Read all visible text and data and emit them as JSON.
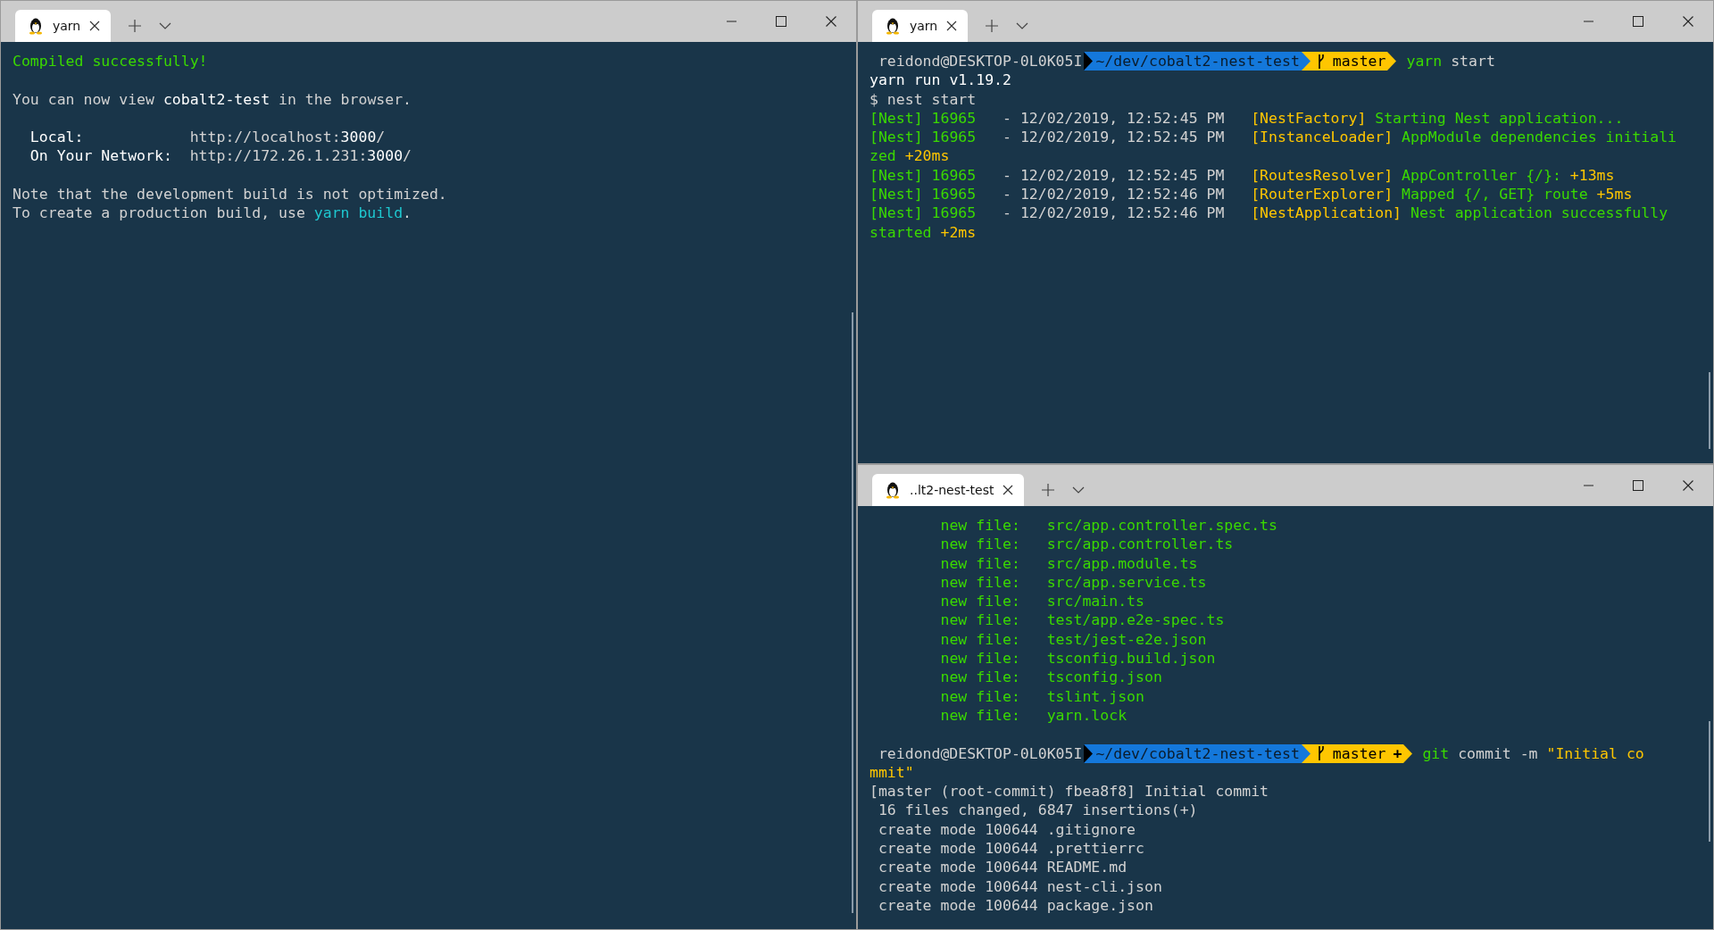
{
  "windows": [
    {
      "tab": {
        "title": "yarn"
      },
      "lines": [
        {
          "kind": "text",
          "spans": [
            {
              "text": "Compiled successfully!",
              "color": "#3ad900"
            }
          ]
        },
        {
          "kind": "blank"
        },
        {
          "kind": "text",
          "spans": [
            {
              "text": "You can now view ",
              "color": "#d2d2d2"
            },
            {
              "text": "cobalt2-test",
              "color": "#ffffff"
            },
            {
              "text": " in the browser.",
              "color": "#d2d2d2"
            }
          ]
        },
        {
          "kind": "blank"
        },
        {
          "kind": "text",
          "spans": [
            {
              "text": "  Local:",
              "color": "#ffffff"
            },
            {
              "text": "            http://localhost:",
              "color": "#d2d2d2"
            },
            {
              "text": "3000",
              "color": "#ffffff"
            },
            {
              "text": "/",
              "color": "#d2d2d2"
            }
          ]
        },
        {
          "kind": "text",
          "spans": [
            {
              "text": "  On Your Network:",
              "color": "#ffffff"
            },
            {
              "text": "  http://172.26.1.231:",
              "color": "#d2d2d2"
            },
            {
              "text": "3000",
              "color": "#ffffff"
            },
            {
              "text": "/",
              "color": "#d2d2d2"
            }
          ]
        },
        {
          "kind": "blank"
        },
        {
          "kind": "text",
          "spans": [
            {
              "text": "Note that the development build is not optimized.",
              "color": "#d2d2d2"
            }
          ]
        },
        {
          "kind": "text",
          "spans": [
            {
              "text": "To create a production build, use ",
              "color": "#d2d2d2"
            },
            {
              "text": "yarn build",
              "color": "#1ec8d0"
            },
            {
              "text": ".",
              "color": "#d2d2d2"
            }
          ]
        }
      ]
    },
    {
      "tab": {
        "title": "yarn"
      },
      "lines": [
        {
          "kind": "prompt",
          "user": "reidond@DESKTOP-0L0K05I",
          "path": "~/dev/cobalt2-nest-test",
          "branch": "master",
          "command": [
            {
              "text": "yarn",
              "color": "#3ad900"
            },
            {
              "text": " start",
              "color": "#d2d2d2"
            }
          ]
        },
        {
          "kind": "text",
          "spans": [
            {
              "text": "yarn run v1.19.2",
              "color": "#ffffff"
            }
          ]
        },
        {
          "kind": "text",
          "spans": [
            {
              "text": "$ nest start",
              "color": "#d2d2d2"
            }
          ]
        },
        {
          "kind": "text",
          "spans": [
            {
              "text": "[Nest] 16965",
              "color": "#3ad900"
            },
            {
              "text": "   - 12/02/2019, 12:52:45 PM   ",
              "color": "#d2d2d2"
            },
            {
              "text": "[NestFactory]",
              "color": "#ffc600"
            },
            {
              "text": " Starting Nest application...",
              "color": "#3ad900"
            }
          ]
        },
        {
          "kind": "text",
          "spans": [
            {
              "text": "[Nest] 16965",
              "color": "#3ad900"
            },
            {
              "text": "   - 12/02/2019, 12:52:45 PM   ",
              "color": "#d2d2d2"
            },
            {
              "text": "[InstanceLoader]",
              "color": "#ffc600"
            },
            {
              "text": " AppModule dependencies initiali",
              "color": "#3ad900"
            }
          ]
        },
        {
          "kind": "text",
          "spans": [
            {
              "text": "zed ",
              "color": "#3ad900"
            },
            {
              "text": "+20ms",
              "color": "#ffc600"
            }
          ]
        },
        {
          "kind": "text",
          "spans": [
            {
              "text": "[Nest] 16965",
              "color": "#3ad900"
            },
            {
              "text": "   - 12/02/2019, 12:52:45 PM   ",
              "color": "#d2d2d2"
            },
            {
              "text": "[RoutesResolver]",
              "color": "#ffc600"
            },
            {
              "text": " AppController {/}: ",
              "color": "#3ad900"
            },
            {
              "text": "+13ms",
              "color": "#ffc600"
            }
          ]
        },
        {
          "kind": "text",
          "spans": [
            {
              "text": "[Nest] 16965",
              "color": "#3ad900"
            },
            {
              "text": "   - 12/02/2019, 12:52:46 PM   ",
              "color": "#d2d2d2"
            },
            {
              "text": "[RouterExplorer]",
              "color": "#ffc600"
            },
            {
              "text": " Mapped {/, GET} route ",
              "color": "#3ad900"
            },
            {
              "text": "+5ms",
              "color": "#ffc600"
            }
          ]
        },
        {
          "kind": "text",
          "spans": [
            {
              "text": "[Nest] 16965",
              "color": "#3ad900"
            },
            {
              "text": "   - 12/02/2019, 12:52:46 PM   ",
              "color": "#d2d2d2"
            },
            {
              "text": "[NestApplication]",
              "color": "#ffc600"
            },
            {
              "text": " Nest application successfully",
              "color": "#3ad900"
            }
          ]
        },
        {
          "kind": "text",
          "spans": [
            {
              "text": "started ",
              "color": "#3ad900"
            },
            {
              "text": "+2ms",
              "color": "#ffc600"
            }
          ]
        }
      ]
    },
    {
      "tab": {
        "title": "..lt2-nest-test"
      },
      "lines": [
        {
          "kind": "text",
          "spans": [
            {
              "text": "        new file:   src/app.controller.spec.ts",
              "color": "#3ad900"
            }
          ]
        },
        {
          "kind": "text",
          "spans": [
            {
              "text": "        new file:   src/app.controller.ts",
              "color": "#3ad900"
            }
          ]
        },
        {
          "kind": "text",
          "spans": [
            {
              "text": "        new file:   src/app.module.ts",
              "color": "#3ad900"
            }
          ]
        },
        {
          "kind": "text",
          "spans": [
            {
              "text": "        new file:   src/app.service.ts",
              "color": "#3ad900"
            }
          ]
        },
        {
          "kind": "text",
          "spans": [
            {
              "text": "        new file:   src/main.ts",
              "color": "#3ad900"
            }
          ]
        },
        {
          "kind": "text",
          "spans": [
            {
              "text": "        new file:   test/app.e2e-spec.ts",
              "color": "#3ad900"
            }
          ]
        },
        {
          "kind": "text",
          "spans": [
            {
              "text": "        new file:   test/jest-e2e.json",
              "color": "#3ad900"
            }
          ]
        },
        {
          "kind": "text",
          "spans": [
            {
              "text": "        new file:   tsconfig.build.json",
              "color": "#3ad900"
            }
          ]
        },
        {
          "kind": "text",
          "spans": [
            {
              "text": "        new file:   tsconfig.json",
              "color": "#3ad900"
            }
          ]
        },
        {
          "kind": "text",
          "spans": [
            {
              "text": "        new file:   tslint.json",
              "color": "#3ad900"
            }
          ]
        },
        {
          "kind": "text",
          "spans": [
            {
              "text": "        new file:   yarn.lock",
              "color": "#3ad900"
            }
          ]
        },
        {
          "kind": "blank"
        },
        {
          "kind": "prompt",
          "user": "reidond@DESKTOP-0L0K05I",
          "path": "~/dev/cobalt2-nest-test",
          "branch": "master",
          "branch_status": "+",
          "command": [
            {
              "text": "git",
              "color": "#3ad900"
            },
            {
              "text": " commit -m ",
              "color": "#d2d2d2"
            },
            {
              "text": "\"Initial co",
              "color": "#ffc600"
            }
          ]
        },
        {
          "kind": "text",
          "spans": [
            {
              "text": "mmit\"",
              "color": "#ffc600"
            }
          ]
        },
        {
          "kind": "text",
          "spans": [
            {
              "text": "[master (root-commit) fbea8f8] Initial commit",
              "color": "#d2d2d2"
            }
          ]
        },
        {
          "kind": "text",
          "spans": [
            {
              "text": " 16 files changed, 6847 insertions(+)",
              "color": "#d2d2d2"
            }
          ]
        },
        {
          "kind": "text",
          "spans": [
            {
              "text": " create mode 100644 .gitignore",
              "color": "#d2d2d2"
            }
          ]
        },
        {
          "kind": "text",
          "spans": [
            {
              "text": " create mode 100644 .prettierrc",
              "color": "#d2d2d2"
            }
          ]
        },
        {
          "kind": "text",
          "spans": [
            {
              "text": " create mode 100644 README.md",
              "color": "#d2d2d2"
            }
          ]
        },
        {
          "kind": "text",
          "spans": [
            {
              "text": " create mode 100644 nest-cli.json",
              "color": "#d2d2d2"
            }
          ]
        },
        {
          "kind": "text",
          "spans": [
            {
              "text": " create mode 100644 package.json",
              "color": "#d2d2d2"
            }
          ]
        }
      ]
    }
  ]
}
